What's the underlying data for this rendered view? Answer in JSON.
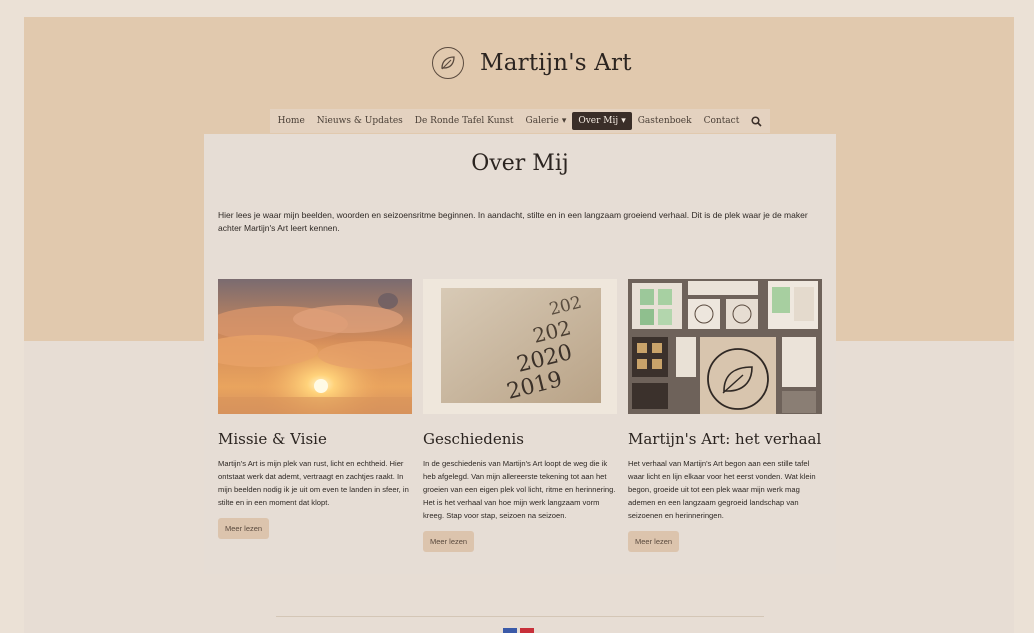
{
  "site": {
    "title": "Martijn's Art"
  },
  "nav": {
    "items": [
      {
        "label": "Home"
      },
      {
        "label": "Nieuws & Updates"
      },
      {
        "label": "De Ronde Tafel Kunst"
      },
      {
        "label": "Galerie",
        "caret": "▾"
      },
      {
        "label": "Over Mij",
        "caret": "▾"
      },
      {
        "label": "Gastenboek"
      },
      {
        "label": "Contact"
      }
    ],
    "search_icon": "search-icon"
  },
  "page": {
    "title": "Over Mij",
    "intro": "Hier lees je waar mijn beelden, woorden en seizoensritme beginnen. In aandacht, stilte en in een langzaam groeiend verhaal. Dit is de plek waar je de maker achter Martijn's Art leert kennen."
  },
  "cards": [
    {
      "title": "Missie & Visie",
      "text": "Martijn's Art is mijn plek van rust, licht en echtheid. Hier ontstaat werk dat ademt, vertraagt en zachtjes raakt. In mijn beelden nodig ik je uit om even te landen in sfeer, in stilte en in een moment dat klopt.",
      "button": "Meer lezen",
      "image": "sunset-clouds"
    },
    {
      "title": "Geschiedenis",
      "text": "In de geschiedenis van Martijn's Art loopt de weg die ik heb afgelegd. Van mijn allereerste tekening tot aan het groeien van een eigen plek vol licht, ritme en herinnering. Het is het verhaal van hoe mijn werk langzaam vorm kreeg. Stap voor stap, seizoen na seizoen.",
      "button": "Meer lezen",
      "image": "calendar-years",
      "years": [
        "202",
        "202",
        "2020",
        "2019"
      ]
    },
    {
      "title": "Martijn's Art: het verhaal",
      "text": "Het verhaal van Martijn's Art begon aan een stille tafel waar licht en lijn elkaar voor het eerst vonden. Wat klein begon, groeide uit tot een plek waar mijn werk mag ademen en een langzaam gegroeid landschap van seizoenen en herinneringen.",
      "button": "Meer lezen",
      "image": "stationery-leaf"
    }
  ],
  "colors": {
    "header_bg": "#e1c9ae",
    "page_bg": "#e7ddd4",
    "active_nav": "#3a2e28",
    "button_bg": "#dcc4ad"
  }
}
